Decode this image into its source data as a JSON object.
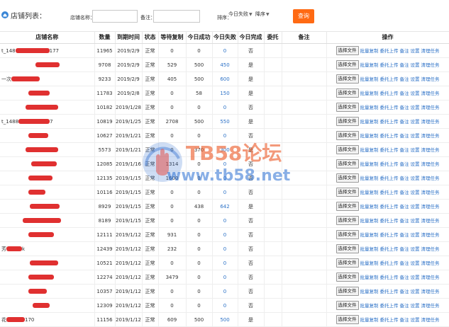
{
  "header": {
    "title": "店铺列表：",
    "shop_name_label": "店铺名称：",
    "shop_name_value": "",
    "remark_label": "备注：",
    "remark_value": "",
    "sort_label": "排序：",
    "sort_field": "今日失败",
    "sort_order": "降序",
    "query_button": "查询"
  },
  "columns": [
    "店铺名称",
    "数量",
    "到期时间",
    "状态",
    "等待复制",
    "今日成功",
    "今日失败",
    "今日完成",
    "委托",
    "备注",
    "操作"
  ],
  "row_actions": {
    "file_button": "选择文件",
    "links": [
      "批量复制",
      "委托上传",
      "备注",
      "设置",
      "清理任务"
    ]
  },
  "rows": [
    {
      "name_prefix": "t_148",
      "name_suffix": "177",
      "count": "11965",
      "expire": "2019/2/9",
      "status": "正常",
      "waiting": "0",
      "success": "0",
      "fail": "0",
      "done": "否"
    },
    {
      "name_prefix": "",
      "name_suffix": "",
      "count": "9708",
      "expire": "2019/2/9",
      "status": "正常",
      "waiting": "529",
      "success": "500",
      "fail": "450",
      "done": "是"
    },
    {
      "name_prefix": "一次",
      "name_suffix": "",
      "count": "9233",
      "expire": "2019/2/9",
      "status": "正常",
      "waiting": "405",
      "success": "500",
      "fail": "600",
      "done": "是"
    },
    {
      "name_prefix": "",
      "name_suffix": "",
      "count": "11783",
      "expire": "2019/2/8",
      "status": "正常",
      "waiting": "0",
      "success": "58",
      "fail": "150",
      "done": "是"
    },
    {
      "name_prefix": "",
      "name_suffix": "",
      "count": "10182",
      "expire": "2019/1/28",
      "status": "正常",
      "waiting": "0",
      "success": "0",
      "fail": "0",
      "done": "否"
    },
    {
      "name_prefix": "t_1488",
      "name_suffix": "7",
      "count": "10819",
      "expire": "2019/1/25",
      "status": "正常",
      "waiting": "2708",
      "success": "500",
      "fail": "550",
      "done": "是"
    },
    {
      "name_prefix": "",
      "name_suffix": "",
      "count": "10627",
      "expire": "2019/1/21",
      "status": "正常",
      "waiting": "0",
      "success": "0",
      "fail": "0",
      "done": "否"
    },
    {
      "name_prefix": "",
      "name_suffix": "",
      "count": "5573",
      "expire": "2019/1/21",
      "status": "正常",
      "waiting": "0",
      "success": "370",
      "fail": "300",
      "done": "是"
    },
    {
      "name_prefix": "",
      "name_suffix": "",
      "count": "12085",
      "expire": "2019/1/16",
      "status": "正常",
      "waiting": "1314",
      "success": "0",
      "fail": "0",
      "done": "否"
    },
    {
      "name_prefix": "",
      "name_suffix": "",
      "count": "12135",
      "expire": "2019/1/15",
      "status": "正常",
      "waiting": "1600",
      "success": "0",
      "fail": "0",
      "done": "否"
    },
    {
      "name_prefix": "",
      "name_suffix": "",
      "count": "10116",
      "expire": "2019/1/15",
      "status": "正常",
      "waiting": "0",
      "success": "0",
      "fail": "0",
      "done": "否"
    },
    {
      "name_prefix": "",
      "name_suffix": "",
      "count": "8929",
      "expire": "2019/1/15",
      "status": "正常",
      "waiting": "0",
      "success": "438",
      "fail": "642",
      "done": "是"
    },
    {
      "name_prefix": "",
      "name_suffix": "",
      "count": "8189",
      "expire": "2019/1/15",
      "status": "正常",
      "waiting": "0",
      "success": "0",
      "fail": "0",
      "done": "否"
    },
    {
      "name_prefix": "",
      "name_suffix": "",
      "count": "12111",
      "expire": "2019/1/12",
      "status": "正常",
      "waiting": "931",
      "success": "0",
      "fail": "0",
      "done": "否"
    },
    {
      "name_prefix": "芳",
      "name_suffix": "k",
      "count": "12439",
      "expire": "2019/1/12",
      "status": "正常",
      "waiting": "232",
      "success": "0",
      "fail": "0",
      "done": "否"
    },
    {
      "name_prefix": "",
      "name_suffix": "",
      "count": "10521",
      "expire": "2019/1/12",
      "status": "正常",
      "waiting": "0",
      "success": "0",
      "fail": "0",
      "done": "否"
    },
    {
      "name_prefix": "",
      "name_suffix": "",
      "count": "12274",
      "expire": "2019/1/12",
      "status": "正常",
      "waiting": "3479",
      "success": "0",
      "fail": "0",
      "done": "否"
    },
    {
      "name_prefix": "",
      "name_suffix": "",
      "count": "10357",
      "expire": "2019/1/12",
      "status": "正常",
      "waiting": "0",
      "success": "0",
      "fail": "0",
      "done": "否"
    },
    {
      "name_prefix": "",
      "name_suffix": "",
      "count": "12309",
      "expire": "2019/1/12",
      "status": "正常",
      "waiting": "0",
      "success": "0",
      "fail": "0",
      "done": "否"
    },
    {
      "name_prefix": "花",
      "name_suffix": "170",
      "count": "11156",
      "expire": "2019/1/12",
      "status": "正常",
      "waiting": "609",
      "success": "500",
      "fail": "500",
      "done": "是"
    }
  ],
  "watermark": {
    "top": "TB58论坛",
    "bottom": "www.tb58.net"
  },
  "colors": {
    "accent": "#ff6a13",
    "link": "#2d72c7",
    "redaction": "#e03030"
  }
}
